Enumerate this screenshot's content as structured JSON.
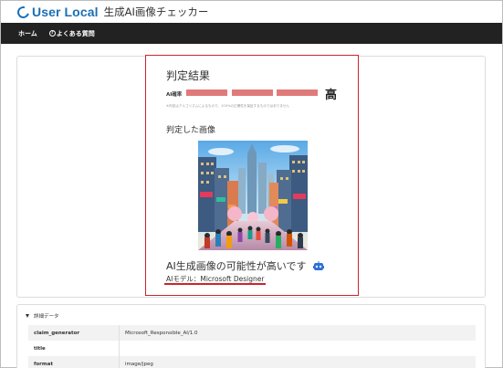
{
  "header": {
    "logo_text": "User Local",
    "app_title": "生成AI画像チェッカー"
  },
  "nav": {
    "home": "ホーム",
    "faq": "よくある質問"
  },
  "result": {
    "title": "判定結果",
    "ai_label": "AI確率",
    "verdict": "高",
    "probability_level_bars": 3,
    "disclaimer": "※判定はアルゴリズムによるもので、100%の正確性を保証するものではありません",
    "judged_image_label": "判定した画像",
    "probability_text": "AI生成画像の可能性が高いです",
    "model_text": "AIモデル：Microsoft Designer"
  },
  "details": {
    "toggle_label": "詳細データ",
    "rows": [
      {
        "key": "claim_generator",
        "value": "Microsoft_Responsible_AI/1.0"
      },
      {
        "key": "title",
        "value": ""
      },
      {
        "key": "format",
        "value": "image/jpeg"
      }
    ]
  },
  "colors": {
    "brand": "#1a6fb5",
    "navbar": "#222222",
    "accent_red": "#c9262c",
    "bar_red": "#e07a7a"
  }
}
